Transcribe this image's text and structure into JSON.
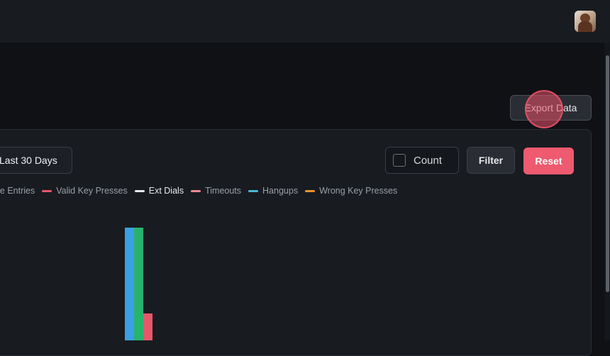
{
  "header": {
    "avatar": "user-avatar"
  },
  "actions": {
    "export_label": "Export Data"
  },
  "filters": {
    "date_range_label": "Last 30 Days",
    "count_label": "Count",
    "count_checked": false,
    "filter_label": "Filter",
    "reset_label": "Reset"
  },
  "colors": {
    "reset": "#ee5a6f",
    "blue": "#3aa0e3",
    "green": "#27b36d",
    "red": "#e8566b"
  },
  "chart_data": {
    "type": "bar",
    "legend": [
      {
        "name": "Unique Entries",
        "color": "#27b36d",
        "active": false
      },
      {
        "name": "Valid Key Presses",
        "color": "#e8566b",
        "active": false
      },
      {
        "name": "Ext Dials",
        "color": "#e6e8eb",
        "active": true
      },
      {
        "name": "Timeouts",
        "color": "#f08a92",
        "active": false
      },
      {
        "name": "Hangups",
        "color": "#4db6d9",
        "active": false
      },
      {
        "name": "Wrong Key Presses",
        "color": "#f0922c",
        "active": false
      }
    ],
    "bars": [
      {
        "series": "blue",
        "value": 159
      },
      {
        "series": "green",
        "value": 159
      },
      {
        "series": "red",
        "value": 38
      }
    ]
  }
}
